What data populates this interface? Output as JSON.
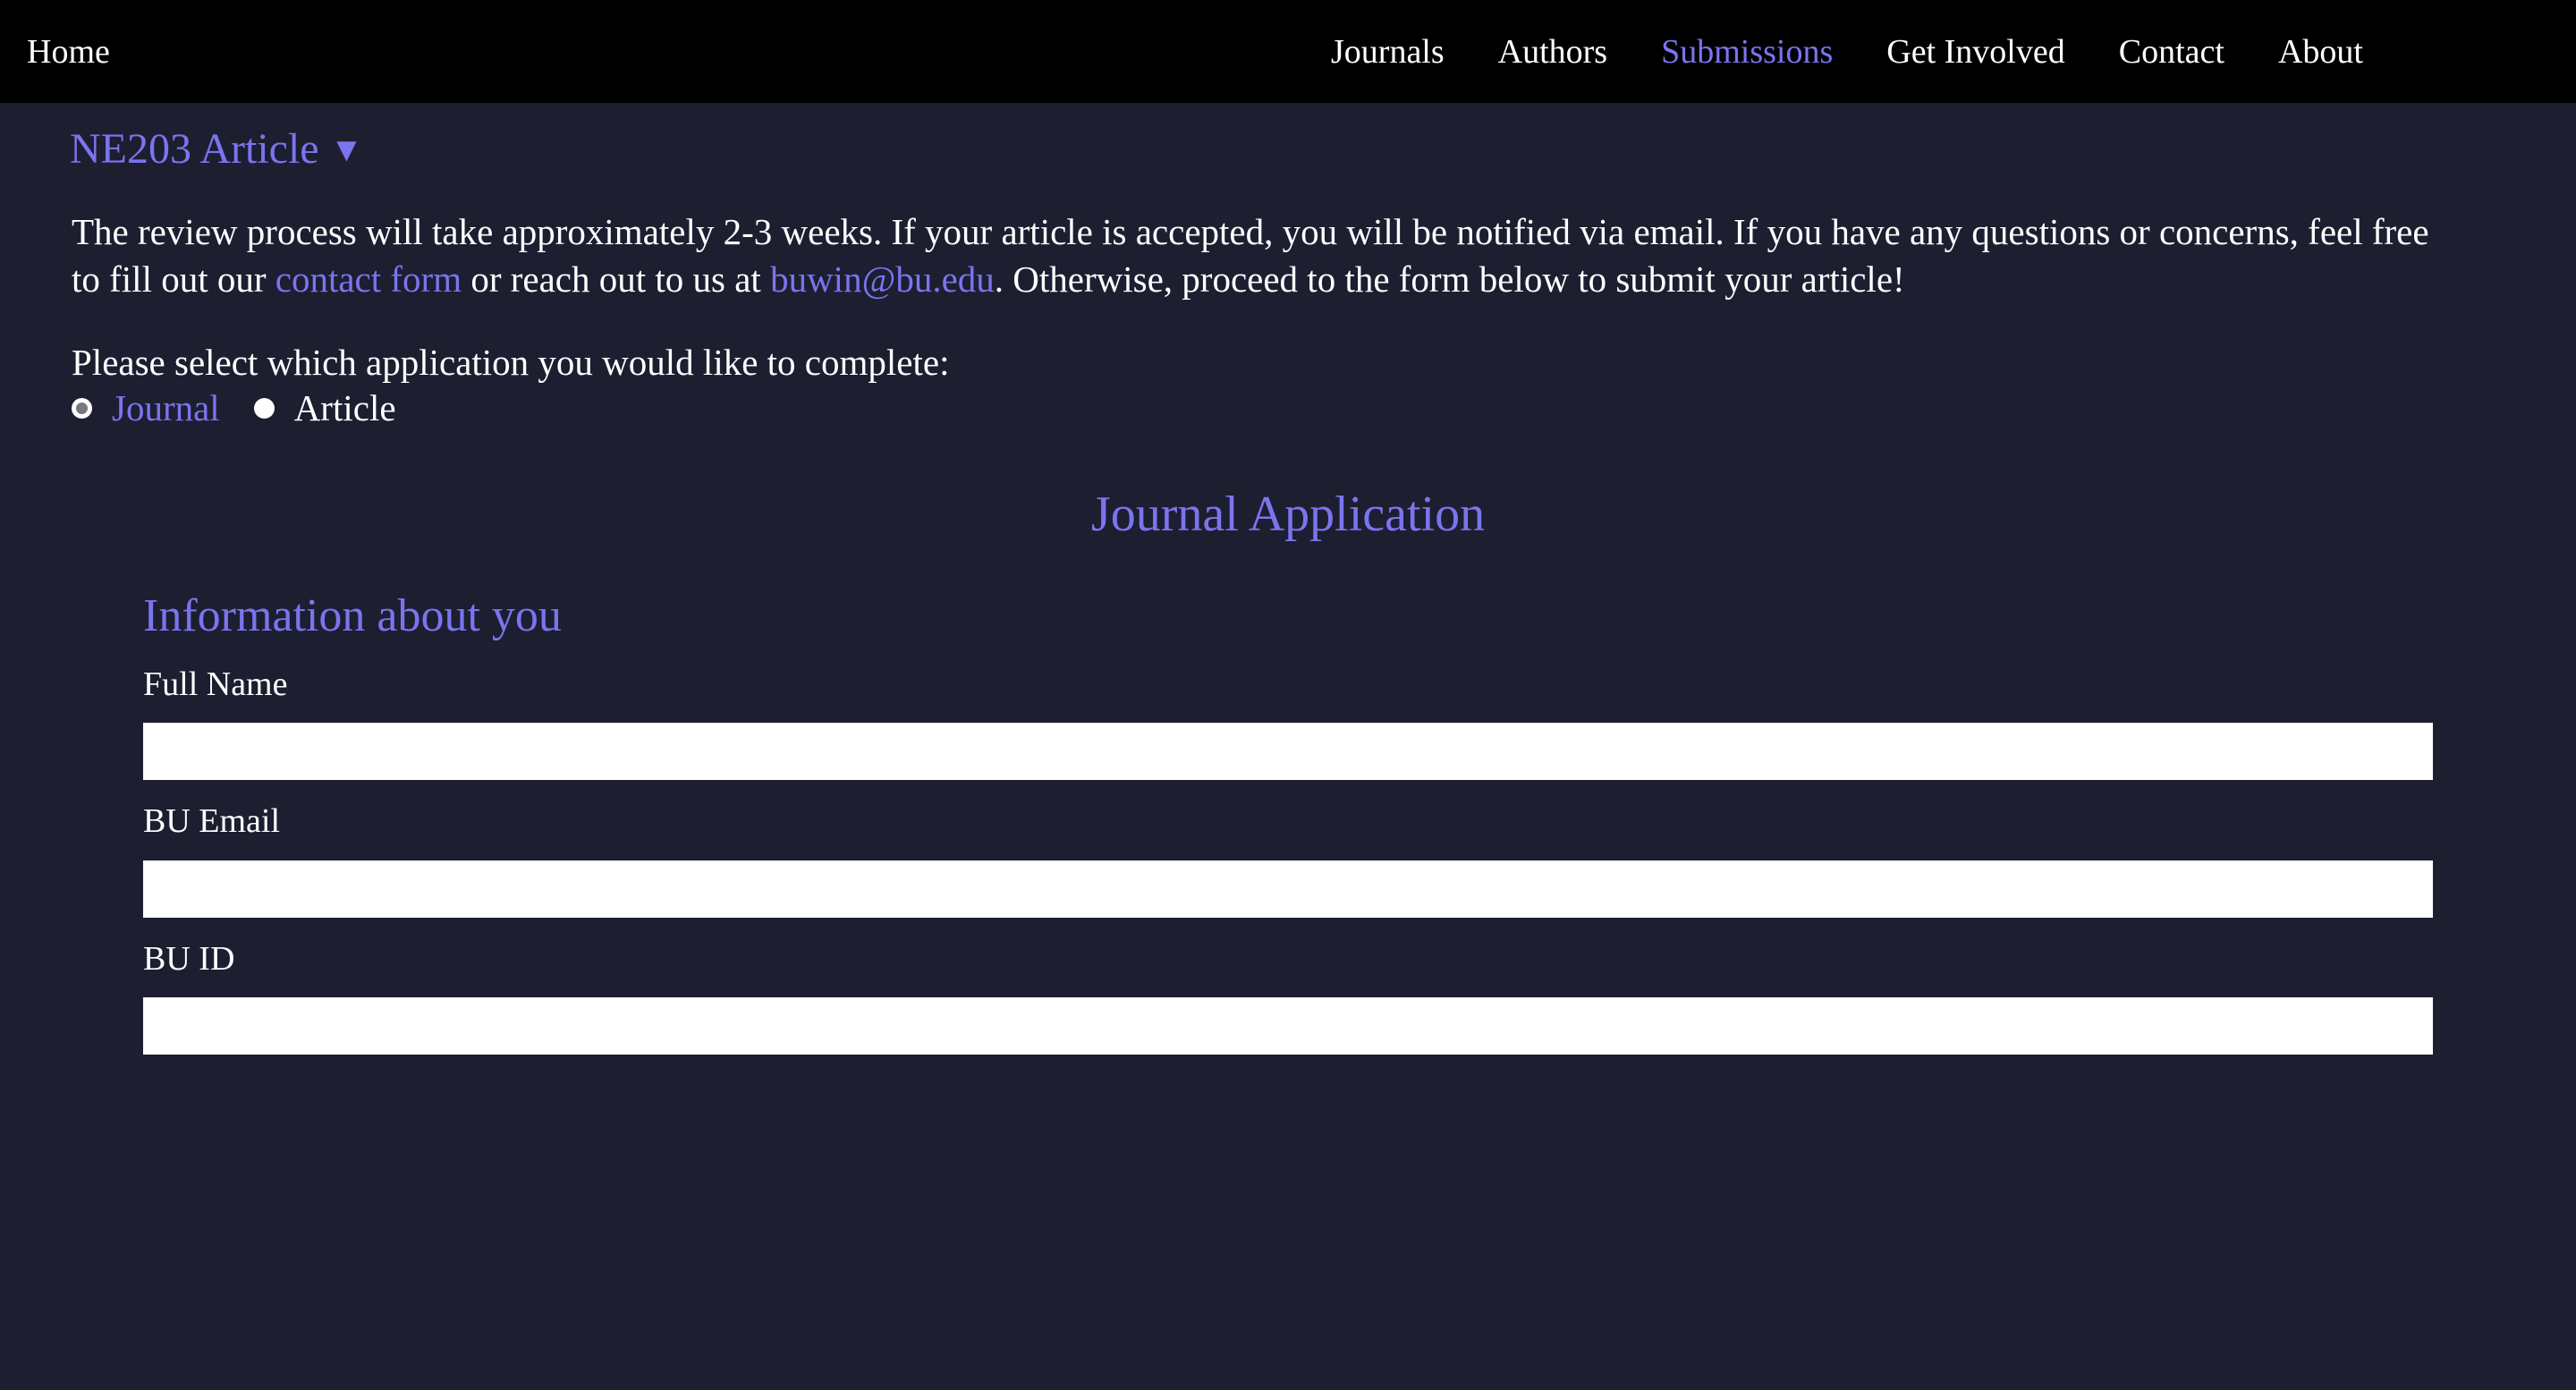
{
  "colors": {
    "page_bg": "#1d1e30",
    "navbar_bg": "#000000",
    "accent": "#7b74ef",
    "text": "#ffffff",
    "input_bg": "#ffffff"
  },
  "navbar": {
    "home_label": "Home",
    "links": [
      {
        "label": "Journals",
        "active": false
      },
      {
        "label": "Authors",
        "active": false
      },
      {
        "label": "Submissions",
        "active": true
      },
      {
        "label": "Get Involved",
        "active": false
      },
      {
        "label": "Contact",
        "active": false
      },
      {
        "label": "About",
        "active": false
      }
    ]
  },
  "main": {
    "section_toggle_label": "NE203 Article",
    "section_toggle_caret": "▼",
    "intro": {
      "part1": "The review process will take approximately 2-3 weeks. If your article is accepted, you will be notified via email. If you have any questions or concerns, feel free to fill out our ",
      "link_contact": "contact form",
      "part2": " or reach out to us at ",
      "link_email": "buwin@bu.edu",
      "part3": ". Otherwise, proceed to the form below to submit your article!"
    },
    "select_prompt": "Please select which application you would like to complete:",
    "options": [
      {
        "label": "Journal",
        "checked": true
      },
      {
        "label": "Article",
        "checked": false
      }
    ],
    "form_title": "Journal Application",
    "form_section_title": "Information about you",
    "fields": [
      {
        "label": "Full Name",
        "value": "",
        "placeholder": ""
      },
      {
        "label": "BU Email",
        "value": "",
        "placeholder": ""
      },
      {
        "label": "BU ID",
        "value": "",
        "placeholder": ""
      }
    ]
  }
}
